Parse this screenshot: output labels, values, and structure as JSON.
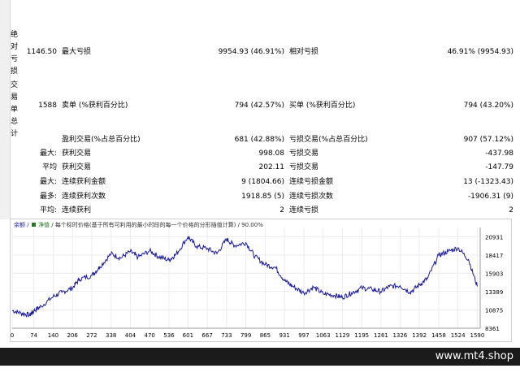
{
  "left_labels": {
    "absolute_drawdown": [
      "绝",
      "对",
      "亏",
      "损"
    ],
    "total_trades": [
      "交",
      "易",
      "单",
      "总",
      "计"
    ]
  },
  "stats": {
    "row1": {
      "value1": "1146.50",
      "label2": "最大亏损",
      "value2": "9954.93 (46.91%)",
      "label3": "相对亏损",
      "value3": "46.91% (9954.93)"
    },
    "row2": {
      "value1": "1588",
      "label2": "卖单 (%获利百分比)",
      "value2": "794 (42.57%)",
      "label3": "买单 (%获利百分比)",
      "value3": "794 (43.20%)"
    },
    "rows": [
      {
        "prefix": "",
        "label2": "盈利交易(%占总百分比)",
        "value2": "681 (42.88%)",
        "label3": "亏损交易(%占总百分比)",
        "value3": "907 (57.12%)"
      },
      {
        "prefix": "最大:",
        "label2": "获利交易",
        "value2": "998.08",
        "label3": "亏损交易",
        "value3": "-437.98"
      },
      {
        "prefix": "平均",
        "label2": "获利交易",
        "value2": "202.11",
        "label3": "亏损交易",
        "value3": "-147.79"
      },
      {
        "prefix": "最大:",
        "label2": "连续获利金额",
        "value2": "9 (1804.66)",
        "label3": "连续亏损金额",
        "value3": "13 (-1323.43)"
      },
      {
        "prefix": "最多:",
        "label2": "连续获利次数",
        "value2": "1918.85 (5)",
        "label3": "连续亏损次数",
        "value3": "-1906.31 (9)"
      },
      {
        "prefix": "平均:",
        "label2": "连续获利",
        "value2": "2",
        "label3": "连续亏损",
        "value3": "2"
      }
    ]
  },
  "chart_legend": {
    "series1": "余额",
    "sep1": "/",
    "series2": "净值",
    "sep2": "/",
    "note": "每个标时价格(基于所有可利用的最小时段的每一个价格的分形插值计算) / 90.00%"
  },
  "chart_data": {
    "type": "line",
    "x_ticks": [
      "0",
      "74",
      "140",
      "206",
      "272",
      "338",
      "404",
      "470",
      "536",
      "601",
      "667",
      "733",
      "799",
      "865",
      "931",
      "997",
      "1063",
      "1129",
      "1195",
      "1261",
      "1326",
      "1392",
      "1458",
      "1524",
      "1590"
    ],
    "y_ticks": [
      "20931",
      "18417",
      "15903",
      "13389",
      "10875",
      "8361"
    ],
    "ylim": [
      8361,
      22188
    ],
    "xlim": [
      0,
      1600
    ],
    "series": [
      {
        "color": "#1a1a9a",
        "points": [
          [
            0,
            10800
          ],
          [
            30,
            10450
          ],
          [
            60,
            10150
          ],
          [
            74,
            10750
          ],
          [
            100,
            11400
          ],
          [
            140,
            12700
          ],
          [
            170,
            13300
          ],
          [
            206,
            13900
          ],
          [
            230,
            15100
          ],
          [
            272,
            15600
          ],
          [
            300,
            16800
          ],
          [
            338,
            18600
          ],
          [
            370,
            18000
          ],
          [
            404,
            18900
          ],
          [
            430,
            18100
          ],
          [
            470,
            19000
          ],
          [
            500,
            18200
          ],
          [
            536,
            17700
          ],
          [
            560,
            18500
          ],
          [
            601,
            20900
          ],
          [
            630,
            19600
          ],
          [
            667,
            19300
          ],
          [
            700,
            18600
          ],
          [
            733,
            20600
          ],
          [
            760,
            19700
          ],
          [
            799,
            20100
          ],
          [
            830,
            18200
          ],
          [
            865,
            17100
          ],
          [
            900,
            16700
          ],
          [
            931,
            14900
          ],
          [
            960,
            14100
          ],
          [
            997,
            13200
          ],
          [
            1030,
            14000
          ],
          [
            1063,
            13100
          ],
          [
            1100,
            12900
          ],
          [
            1129,
            12600
          ],
          [
            1160,
            13200
          ],
          [
            1195,
            13900
          ],
          [
            1230,
            13700
          ],
          [
            1261,
            13400
          ],
          [
            1290,
            14100
          ],
          [
            1326,
            14200
          ],
          [
            1360,
            13300
          ],
          [
            1392,
            14300
          ],
          [
            1420,
            15200
          ],
          [
            1458,
            18400
          ],
          [
            1490,
            18900
          ],
          [
            1524,
            19400
          ],
          [
            1560,
            17800
          ],
          [
            1590,
            14100
          ]
        ]
      }
    ]
  },
  "footer": {
    "brand": "www.mt4.shop"
  }
}
